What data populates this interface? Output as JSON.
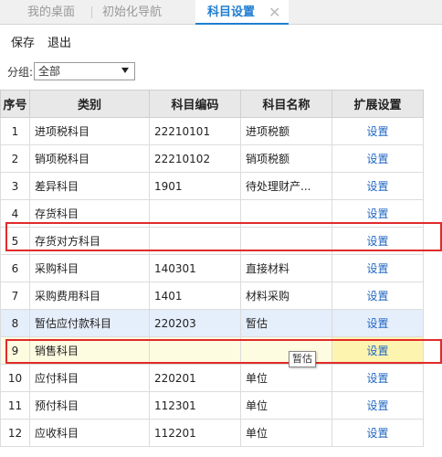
{
  "tabs": {
    "home": "我的桌面",
    "init_nav": "初始化导航",
    "active": "科目设置",
    "close_glyph": "✕"
  },
  "toolbar": {
    "save_label": "保存",
    "exit_label": "退出"
  },
  "filter": {
    "label": "分组:",
    "selected": "全部"
  },
  "grid": {
    "columns": [
      "序号",
      "类别",
      "科目编码",
      "科目名称",
      "扩展设置"
    ],
    "rows": [
      {
        "idx": "1",
        "category": "进项税科目",
        "code": "22210101",
        "name": "进项税额",
        "action": "设置"
      },
      {
        "idx": "2",
        "category": "销项税科目",
        "code": "22210102",
        "name": "销项税额",
        "action": "设置"
      },
      {
        "idx": "3",
        "category": "差异科目",
        "code": "1901",
        "name": "待处理财产...",
        "action": "设置"
      },
      {
        "idx": "4",
        "category": "存货科目",
        "code": "",
        "name": "",
        "action": "设置"
      },
      {
        "idx": "5",
        "category": "存货对方科目",
        "code": "",
        "name": "",
        "action": "设置"
      },
      {
        "idx": "6",
        "category": "采购科目",
        "code": "140301",
        "name": "直接材料",
        "action": "设置"
      },
      {
        "idx": "7",
        "category": "采购费用科目",
        "code": "1401",
        "name": "材料采购",
        "action": "设置"
      },
      {
        "idx": "8",
        "category": "暂估应付款科目",
        "code": "220203",
        "name": "暂估",
        "action": "设置"
      },
      {
        "idx": "9",
        "category": "销售科目",
        "code": "",
        "name": "",
        "action": "设置"
      },
      {
        "idx": "10",
        "category": "应付科目",
        "code": "220201",
        "name": "单位",
        "action": "设置"
      },
      {
        "idx": "11",
        "category": "预付科目",
        "code": "112301",
        "name": "单位",
        "action": "设置"
      },
      {
        "idx": "12",
        "category": "应收科目",
        "code": "112201",
        "name": "单位",
        "action": "设置"
      }
    ]
  },
  "tooltip": "暂估",
  "colors": {
    "accent": "#1f7ed1",
    "link": "#1f66c1",
    "highlight_box": "#e12a2a",
    "selected_row": "#e5eefb",
    "editing_row": "#fdfbe0"
  }
}
